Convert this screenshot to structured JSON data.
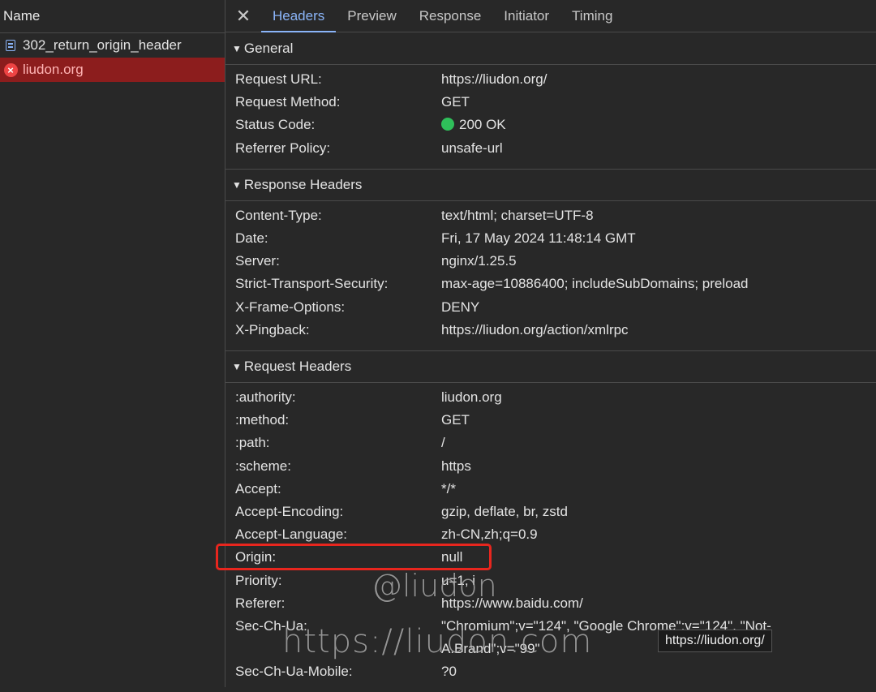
{
  "sidebar": {
    "column_header": "Name",
    "requests": [
      {
        "name": "302_return_origin_header",
        "icon": "document-icon",
        "status": "normal"
      },
      {
        "name": "liudon.org",
        "icon": "error-icon",
        "status": "error"
      }
    ]
  },
  "panel": {
    "close_glyph": "✕",
    "tabs": [
      {
        "label": "Headers",
        "active": true
      },
      {
        "label": "Preview",
        "active": false
      },
      {
        "label": "Response",
        "active": false
      },
      {
        "label": "Initiator",
        "active": false
      },
      {
        "label": "Timing",
        "active": false
      }
    ]
  },
  "general": {
    "title": "General",
    "rows": [
      {
        "key": "Request URL:",
        "value": "https://liudon.org/"
      },
      {
        "key": "Request Method:",
        "value": "GET"
      },
      {
        "key": "Status Code:",
        "value": "200 OK"
      },
      {
        "key": "Referrer Policy:",
        "value": "unsafe-url"
      }
    ]
  },
  "response_headers": {
    "title": "Response Headers",
    "rows": [
      {
        "key": "Content-Type:",
        "value": "text/html; charset=UTF-8"
      },
      {
        "key": "Date:",
        "value": "Fri, 17 May 2024 11:48:14 GMT"
      },
      {
        "key": "Server:",
        "value": "nginx/1.25.5"
      },
      {
        "key": "Strict-Transport-Security:",
        "value": "max-age=10886400; includeSubDomains; preload"
      },
      {
        "key": "X-Frame-Options:",
        "value": "DENY"
      },
      {
        "key": "X-Pingback:",
        "value": "https://liudon.org/action/xmlrpc"
      }
    ]
  },
  "request_headers": {
    "title": "Request Headers",
    "rows": [
      {
        "key": ":authority:",
        "value": "liudon.org"
      },
      {
        "key": ":method:",
        "value": "GET"
      },
      {
        "key": ":path:",
        "value": "/"
      },
      {
        "key": ":scheme:",
        "value": "https"
      },
      {
        "key": "Accept:",
        "value": "*/*"
      },
      {
        "key": "Accept-Encoding:",
        "value": "gzip, deflate, br, zstd"
      },
      {
        "key": "Accept-Language:",
        "value": "zh-CN,zh;q=0.9"
      },
      {
        "key": "Origin:",
        "value": "null"
      },
      {
        "key": "Priority:",
        "value": "u=1, i"
      },
      {
        "key": "Referer:",
        "value": "https://www.baidu.com/"
      },
      {
        "key": "Sec-Ch-Ua:",
        "value": "\"Chromium\";v=\"124\", \"Google Chrome\";v=\"124\", \"Not-A.Brand\";v=\"99\""
      },
      {
        "key": "Sec-Ch-Ua-Mobile:",
        "value": "?0"
      }
    ]
  },
  "tooltip": "https://liudon.org/",
  "watermark": {
    "line1": "@liudon",
    "line2": "https://liudon.com"
  },
  "colors": {
    "accent": "#8ab4f8",
    "error_row": "#8c1d1d",
    "status_ok": "#2fbf5a",
    "highlight": "#e8261e"
  }
}
